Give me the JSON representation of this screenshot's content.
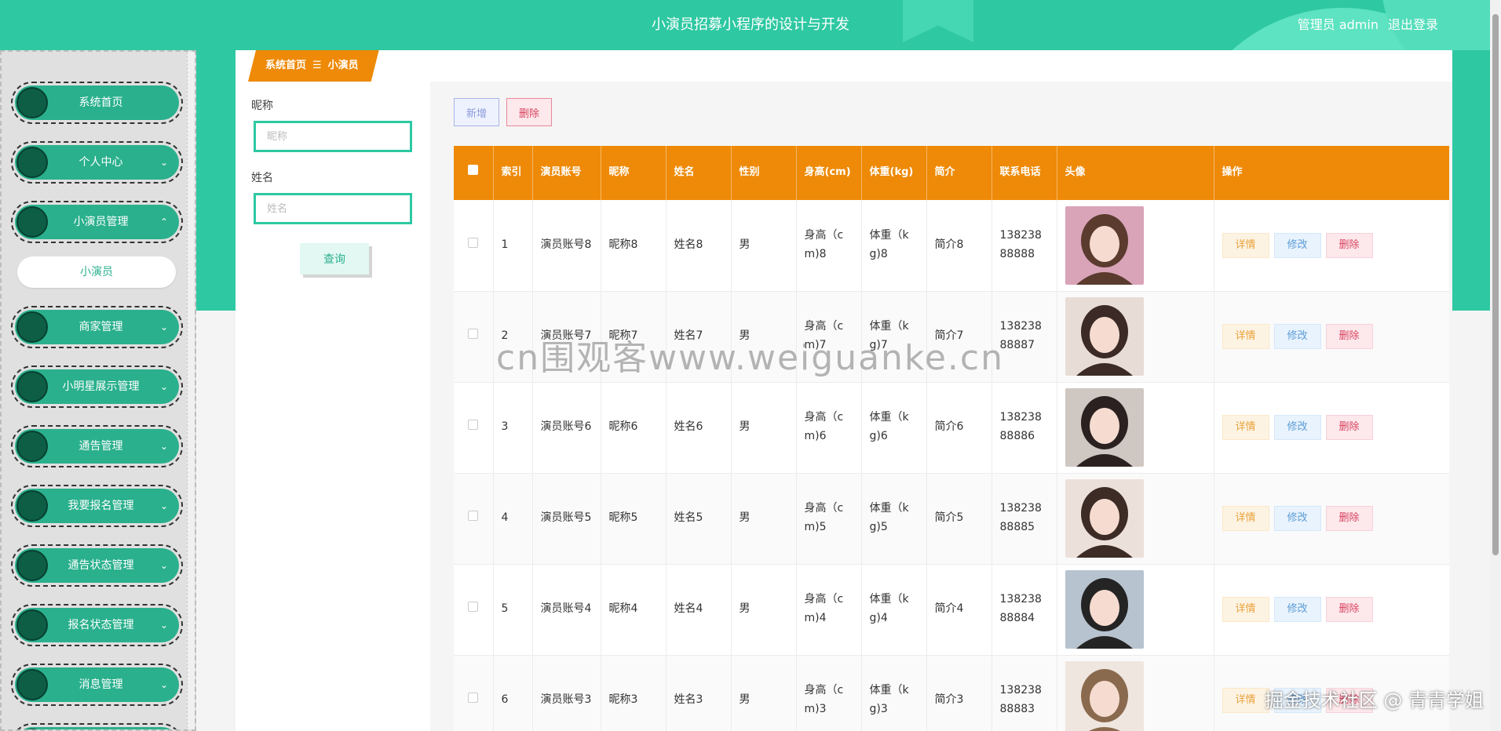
{
  "header": {
    "title": "小演员招募小程序的设计与开发",
    "user_label": "管理员 admin",
    "logout_label": "退出登录"
  },
  "sidebar": {
    "items": [
      {
        "label": "系统首页",
        "arrow": ""
      },
      {
        "label": "个人中心",
        "arrow": "⌄"
      },
      {
        "label": "小演员管理",
        "arrow": "⌃"
      },
      {
        "label": "商家管理",
        "arrow": "⌄"
      },
      {
        "label": "小明星展示管理",
        "arrow": "⌄"
      },
      {
        "label": "通告管理",
        "arrow": "⌄"
      },
      {
        "label": "我要报名管理",
        "arrow": "⌄"
      },
      {
        "label": "通告状态管理",
        "arrow": "⌄"
      },
      {
        "label": "报名状态管理",
        "arrow": "⌄"
      },
      {
        "label": "消息管理",
        "arrow": "⌄"
      }
    ],
    "submenu": {
      "label": "小演员"
    }
  },
  "breadcrumb": {
    "home": "系统首页",
    "sep": "☰",
    "current": "小演员"
  },
  "search": {
    "nickname_label": "昵称",
    "nickname_placeholder": "昵称",
    "name_label": "姓名",
    "name_placeholder": "姓名",
    "query_label": "查询"
  },
  "toolbar": {
    "add_label": "新增",
    "delete_label": "删除"
  },
  "table": {
    "headers": {
      "index": "索引",
      "account": "演员账号",
      "nickname": "昵称",
      "name": "姓名",
      "gender": "性别",
      "height": "身高(cm)",
      "weight": "体重(kg)",
      "intro": "简介",
      "phone": "联系电话",
      "avatar": "头像",
      "actions": "操作"
    },
    "actions": {
      "detail": "详情",
      "edit": "修改",
      "delete": "删除"
    },
    "rows": [
      {
        "index": "1",
        "account": "演员账号8",
        "nickname": "昵称8",
        "name": "姓名8",
        "gender": "男",
        "height": "身高（cm)8",
        "weight": "体重（kg)8",
        "intro": "简介8",
        "phone": "13823888888",
        "avatar_bg": "#d9a3b8",
        "avatar_fg": "#5a3b2e"
      },
      {
        "index": "2",
        "account": "演员账号7",
        "nickname": "昵称7",
        "name": "姓名7",
        "gender": "男",
        "height": "身高（cm)7",
        "weight": "体重（kg)7",
        "intro": "简介7",
        "phone": "13823888887",
        "avatar_bg": "#e8dcd6",
        "avatar_fg": "#3b2a26"
      },
      {
        "index": "3",
        "account": "演员账号6",
        "nickname": "昵称6",
        "name": "姓名6",
        "gender": "男",
        "height": "身高（cm)6",
        "weight": "体重（kg)6",
        "intro": "简介6",
        "phone": "13823888886",
        "avatar_bg": "#cfc7c2",
        "avatar_fg": "#2a2120"
      },
      {
        "index": "4",
        "account": "演员账号5",
        "nickname": "昵称5",
        "name": "姓名5",
        "gender": "男",
        "height": "身高（cm)5",
        "weight": "体重（kg)5",
        "intro": "简介5",
        "phone": "13823888885",
        "avatar_bg": "#ece1da",
        "avatar_fg": "#3d2b25"
      },
      {
        "index": "5",
        "account": "演员账号4",
        "nickname": "昵称4",
        "name": "姓名4",
        "gender": "男",
        "height": "身高（cm)4",
        "weight": "体重（kg)4",
        "intro": "简介4",
        "phone": "13823888884",
        "avatar_bg": "#b7c3cf",
        "avatar_fg": "#252424"
      },
      {
        "index": "6",
        "account": "演员账号3",
        "nickname": "昵称3",
        "name": "姓名3",
        "gender": "男",
        "height": "身高（cm)3",
        "weight": "体重（kg)3",
        "intro": "简介3",
        "phone": "13823888883",
        "avatar_bg": "#efe6e0",
        "avatar_fg": "#8a6a4e"
      }
    ]
  },
  "watermark": {
    "center": "cn围观客www.weiguanke.cn",
    "corner": "掘金技术社区 @ 青青学姐"
  },
  "colors": {
    "primary": "#2ec8a2",
    "sidebar_item": "#2ab08d",
    "table_header": "#ee8a08",
    "breadcrumb": "#ee8a08"
  }
}
